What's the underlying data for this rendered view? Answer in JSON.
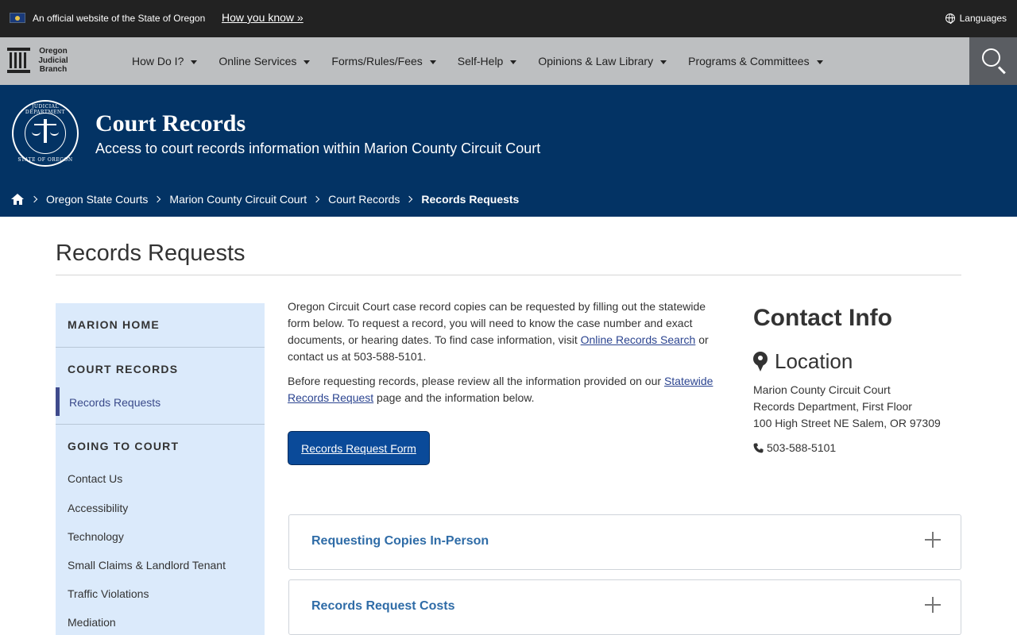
{
  "gov_banner": {
    "text": "An official website of the State of Oregon",
    "how_link": "How you know »",
    "languages": "Languages"
  },
  "nav": {
    "logo_lines": [
      "Oregon",
      "Judicial",
      "Branch"
    ],
    "items": [
      {
        "label": "How Do I?"
      },
      {
        "label": "Online Services"
      },
      {
        "label": "Forms/Rules/Fees"
      },
      {
        "label": "Self-Help"
      },
      {
        "label": "Opinions & Law Library"
      },
      {
        "label": "Programs & Committees"
      }
    ]
  },
  "hero": {
    "seal_top": "JUDICIAL DEPARTMENT",
    "seal_bottom": "STATE OF OREGON",
    "title": "Court Records",
    "subtitle": "Access to court records information within Marion County Circuit Court"
  },
  "breadcrumb": {
    "items": [
      "Oregon State Courts",
      "Marion County Circuit Court",
      "Court Records"
    ],
    "current": "Records Requests"
  },
  "page": {
    "title": "Records Requests"
  },
  "sidebar": {
    "home": "MARION HOME",
    "section1": "COURT RECORDS",
    "active_item": "Records Requests",
    "section2": "GOING TO COURT",
    "links": [
      "Contact Us",
      "Accessibility",
      "Technology",
      "Small Claims & Landlord Tenant",
      "Traffic Violations",
      "Mediation"
    ]
  },
  "main": {
    "p1_a": "Oregon Circuit Court case record copies can be requested by filling out the statewide form below. To request a record, you will need to know the case number and exact documents, or hearing dates. To find case information, visit ",
    "p1_link": "Online Records Search",
    "p1_b": " or contact us at 503-588-5101.",
    "p2_a": "Before requesting records, please review all the information provided on our ",
    "p2_link": "Statewide Records Request",
    "p2_b": " page and the information below.",
    "button": "Records Request Form",
    "accordions": [
      {
        "label": "Requesting Copies In-Person"
      },
      {
        "label": "Records Request Costs"
      }
    ]
  },
  "contact": {
    "title": "Contact Info",
    "location_label": "Location",
    "address_lines": [
      "Marion County Circuit Court",
      "Records Department, First Floor",
      "100 High Street NE Salem, OR 97309"
    ],
    "phone": "503-588-5101"
  }
}
